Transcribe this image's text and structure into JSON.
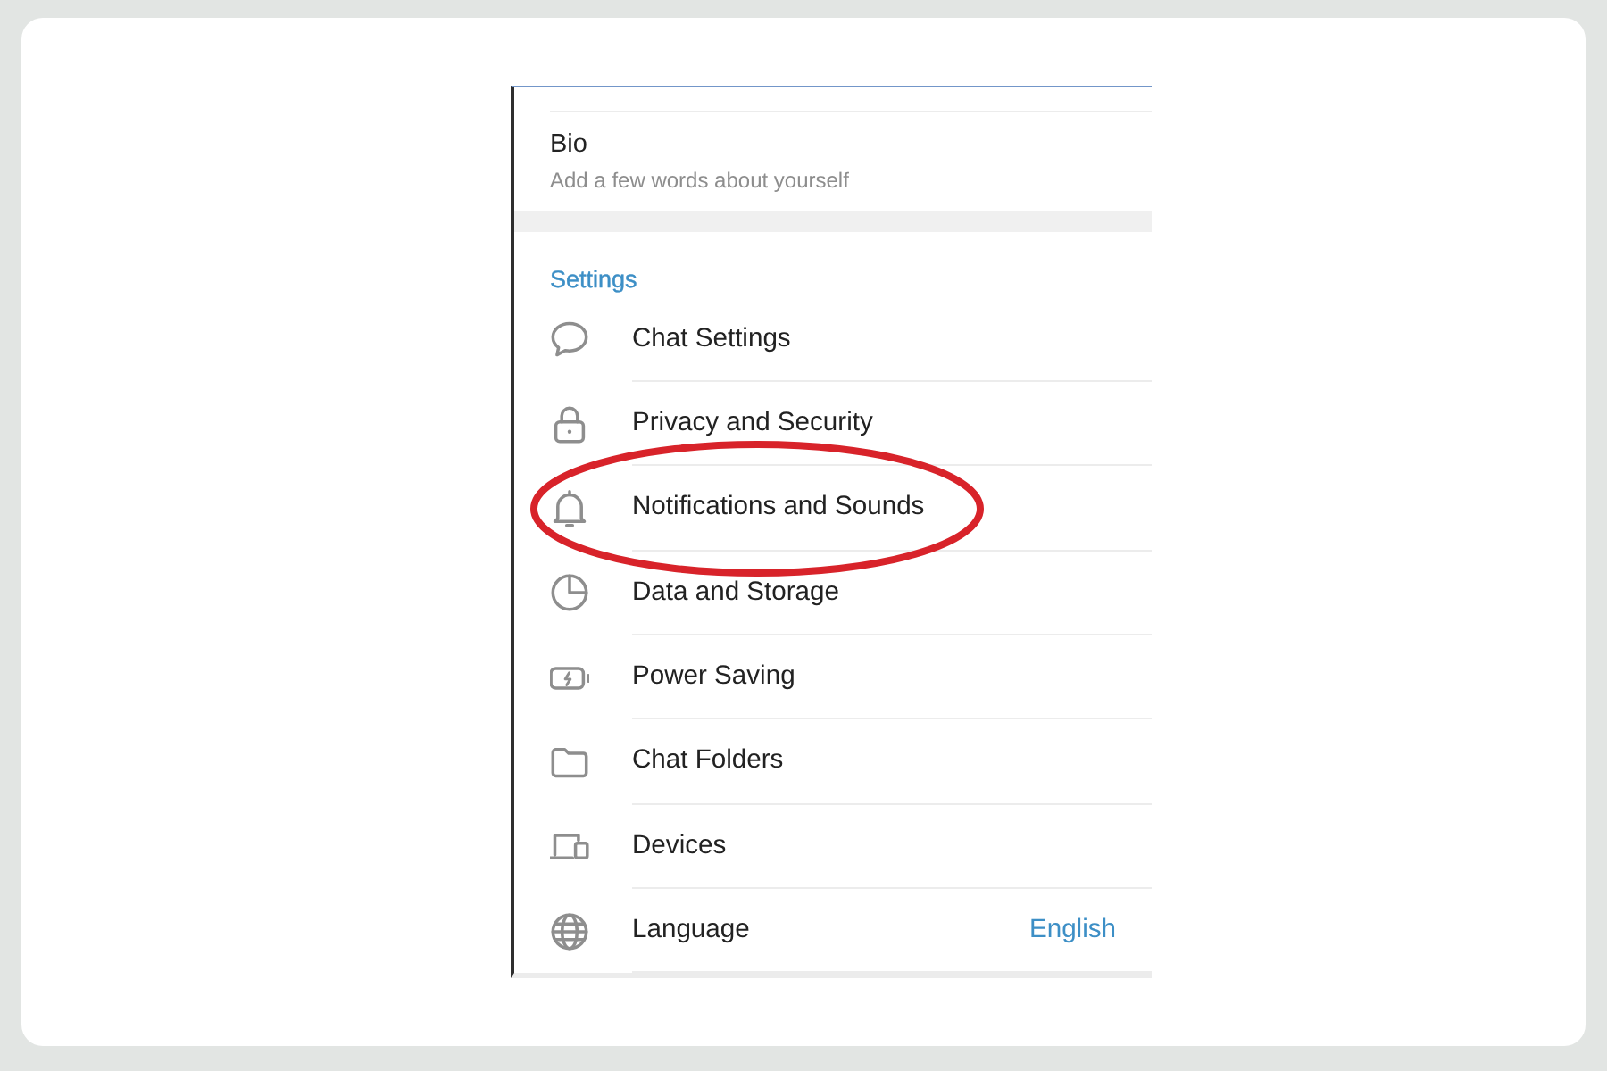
{
  "bio": {
    "title": "Bio",
    "description": "Add a few words about yourself"
  },
  "settings": {
    "header": "Settings",
    "items": [
      {
        "label": "Chat Settings",
        "circled": false
      },
      {
        "label": "Privacy and Security",
        "circled": false
      },
      {
        "label": "Notifications and Sounds",
        "circled": true
      },
      {
        "label": "Data and Storage",
        "circled": false
      },
      {
        "label": "Power Saving",
        "circled": false
      },
      {
        "label": "Chat Folders",
        "circled": false
      },
      {
        "label": "Devices",
        "circled": false
      },
      {
        "label": "Language",
        "value": "English",
        "circled": false
      }
    ]
  }
}
